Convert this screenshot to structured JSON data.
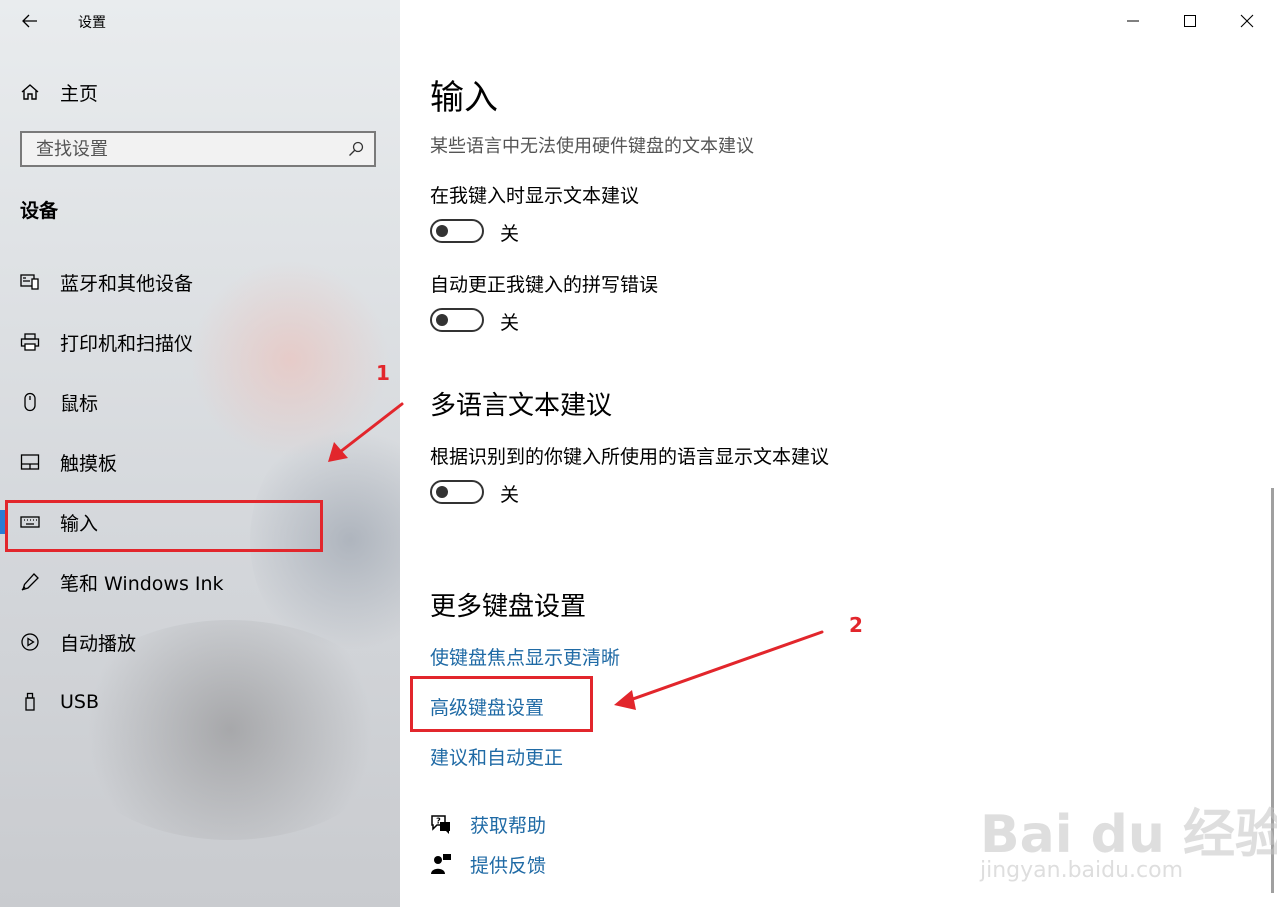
{
  "window": {
    "title": "设置"
  },
  "sidebar": {
    "home_label": "主页",
    "search_placeholder": "查找设置",
    "section": "设备",
    "items": [
      {
        "label": "蓝牙和其他设备",
        "icon": "bluetooth-devices-icon"
      },
      {
        "label": "打印机和扫描仪",
        "icon": "printer-icon"
      },
      {
        "label": "鼠标",
        "icon": "mouse-icon"
      },
      {
        "label": "触摸板",
        "icon": "touchpad-icon"
      },
      {
        "label": "输入",
        "icon": "keyboard-icon",
        "active": true
      },
      {
        "label": "笔和 Windows Ink",
        "icon": "pen-icon"
      },
      {
        "label": "自动播放",
        "icon": "autoplay-icon"
      },
      {
        "label": "USB",
        "icon": "usb-icon"
      }
    ]
  },
  "main": {
    "title": "输入",
    "note": "某些语言中无法使用硬件键盘的文本建议",
    "options": [
      {
        "label": "在我键入时显示文本建议",
        "state": "关"
      },
      {
        "label": "自动更正我键入的拼写错误",
        "state": "关"
      }
    ],
    "multilang": {
      "heading": "多语言文本建议",
      "option": {
        "label": "根据识别到的你键入所使用的语言显示文本建议",
        "state": "关"
      }
    },
    "more_keyboard": {
      "heading": "更多键盘设置",
      "links": [
        "使键盘焦点显示更清晰",
        "高级键盘设置",
        "建议和自动更正"
      ]
    },
    "help": {
      "get_help": "获取帮助",
      "feedback": "提供反馈"
    }
  },
  "annotations": {
    "marker_1": "1",
    "marker_2": "2",
    "color": "#e2262c"
  },
  "watermark": {
    "brand": "Bai du 经验",
    "url": "jingyan.baidu.com"
  },
  "colors": {
    "accent": "#2b7cd3",
    "link": "#1f6aa5"
  }
}
